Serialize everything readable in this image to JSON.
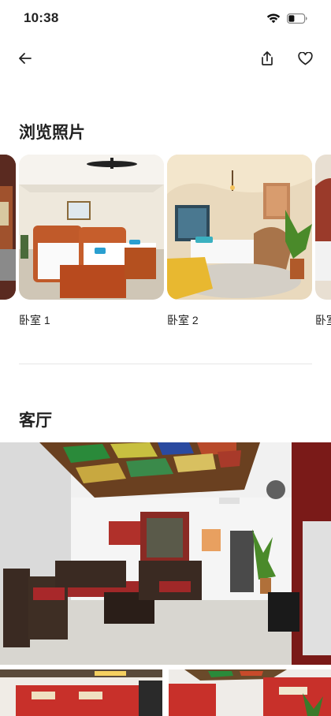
{
  "status_bar": {
    "time": "10:38",
    "wifi_icon": "wifi-icon",
    "battery_icon": "battery-icon"
  },
  "nav": {
    "back_icon": "arrow-left-icon",
    "share_icon": "share-icon",
    "save_icon": "heart-icon"
  },
  "browse": {
    "title": "浏览照片",
    "photos": [
      {
        "label": "卧室 1"
      },
      {
        "label": "卧室 2"
      },
      {
        "label": "卧室"
      }
    ]
  },
  "living_room": {
    "title": "客厅"
  }
}
